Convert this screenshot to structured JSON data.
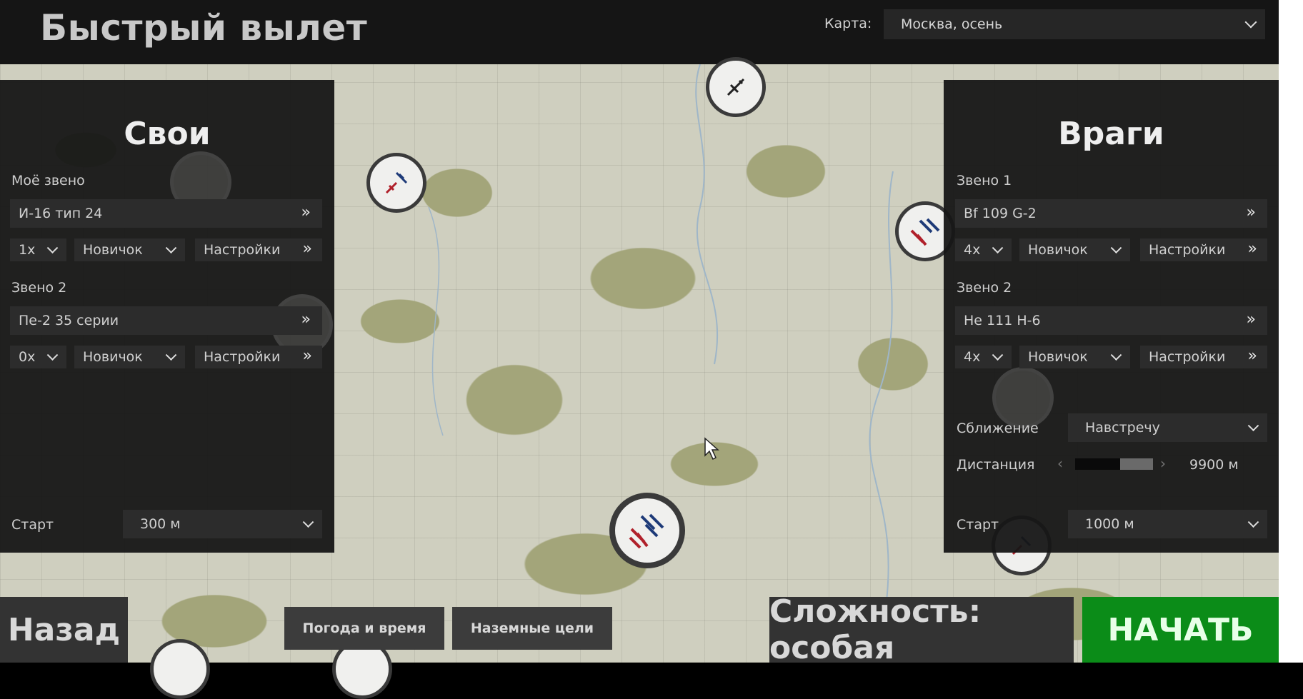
{
  "header": {
    "title": "Быстрый вылет",
    "map_label": "Карта:",
    "map_value": "Москва, осень"
  },
  "left_panel": {
    "title": "Свои",
    "flight1": {
      "label": "Моё звено",
      "aircraft": "И-16 тип 24",
      "count": "1x",
      "skill": "Новичок",
      "settings": "Настройки"
    },
    "flight2": {
      "label": "Звено 2",
      "aircraft": "Пе-2 35 серии",
      "count": "0x",
      "skill": "Новичок",
      "settings": "Настройки"
    },
    "start_label": "Старт",
    "start_value": "300 м"
  },
  "right_panel": {
    "title": "Враги",
    "flight1": {
      "label": "Звено 1",
      "aircraft": "Bf 109 G-2",
      "count": "4x",
      "skill": "Новичок",
      "settings": "Настройки"
    },
    "flight2": {
      "label": "Звено 2",
      "aircraft": "He 111 H-6",
      "count": "4x",
      "skill": "Новичок",
      "settings": "Настройки"
    },
    "approach_label": "Сближение",
    "approach_value": "Навстречу",
    "distance_label": "Дистанция",
    "distance_value": "9900 м",
    "distance_level": 0.42,
    "start_label": "Старт",
    "start_value": "1000 м"
  },
  "footer": {
    "back": "Назад",
    "weather": "Погода и время",
    "ground_targets": "Наземные цели",
    "difficulty": "Сложность: особая",
    "start": "НАЧАТЬ"
  },
  "colors": {
    "start_button": "#0b8c18",
    "panel": "#161616",
    "map": "#cfcfbf",
    "friendly_plane": "#b0202a",
    "enemy_plane": "#1e3a78"
  },
  "icons": [
    "double-chevron-icon",
    "chevron-down-icon",
    "plane-icon",
    "chevron-left-icon",
    "chevron-right-icon",
    "cursor-icon"
  ]
}
